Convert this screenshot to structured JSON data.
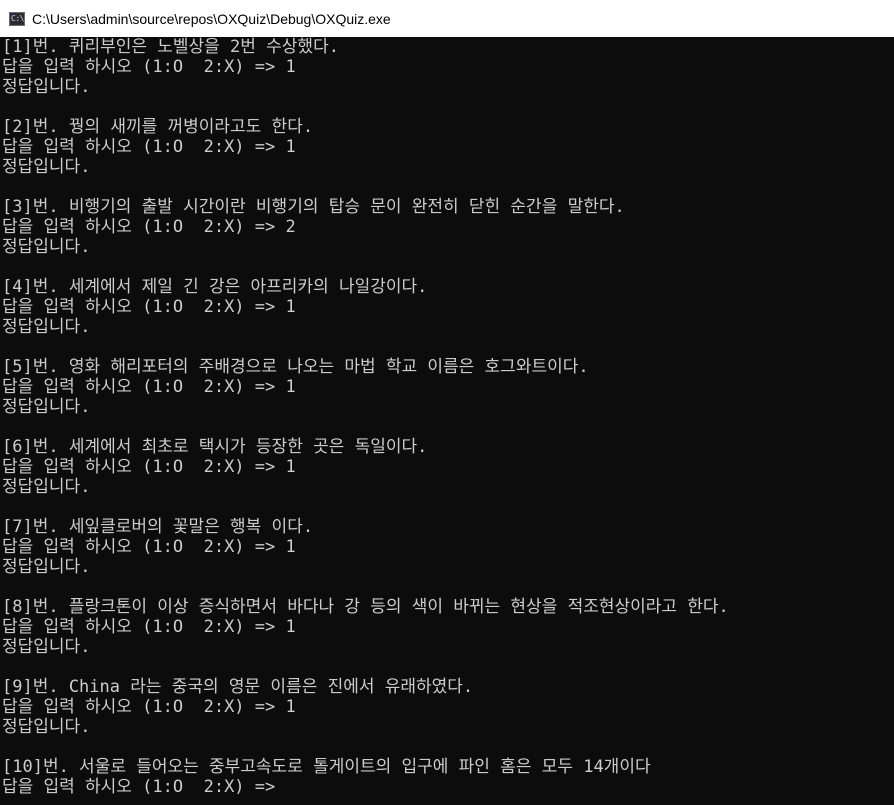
{
  "window": {
    "title": "C:\\Users\\admin\\source\\repos\\OXQuiz\\Debug\\OXQuiz.exe",
    "icon": "console-app-icon",
    "icon_glyph": "C:\\"
  },
  "colors": {
    "console_background": "#0c0c0c",
    "console_text": "#cccccc",
    "titlebar_background": "#ffffff"
  },
  "console": {
    "lines": [
      "[1]번. 퀴리부인은 노벨상을 2번 수상했다.",
      "답을 입력 하시오 (1:O  2:X) => 1",
      "정답입니다.",
      "",
      "[2]번. 꿩의 새끼를 꺼병이라고도 한다.",
      "답을 입력 하시오 (1:O  2:X) => 1",
      "정답입니다.",
      "",
      "[3]번. 비행기의 출발 시간이란 비행기의 탑승 문이 완전히 닫힌 순간을 말한다.",
      "답을 입력 하시오 (1:O  2:X) => 2",
      "정답입니다.",
      "",
      "[4]번. 세계에서 제일 긴 강은 아프리카의 나일강이다.",
      "답을 입력 하시오 (1:O  2:X) => 1",
      "정답입니다.",
      "",
      "[5]번. 영화 해리포터의 주배경으로 나오는 마법 학교 이름은 호그와트이다.",
      "답을 입력 하시오 (1:O  2:X) => 1",
      "정답입니다.",
      "",
      "[6]번. 세계에서 최초로 택시가 등장한 곳은 독일이다.",
      "답을 입력 하시오 (1:O  2:X) => 1",
      "정답입니다.",
      "",
      "[7]번. 세잎클로버의 꽃말은 행복 이다.",
      "답을 입력 하시오 (1:O  2:X) => 1",
      "정답입니다.",
      "",
      "[8]번. 플랑크톤이 이상 증식하면서 바다나 강 등의 색이 바뀌는 현상을 적조현상이라고 한다.",
      "답을 입력 하시오 (1:O  2:X) => 1",
      "정답입니다.",
      "",
      "[9]번. China 라는 중국의 영문 이름은 진에서 유래하였다.",
      "답을 입력 하시오 (1:O  2:X) => 1",
      "정답입니다.",
      "",
      "[10]번. 서울로 들어오는 중부고속도로 톨게이트의 입구에 파인 홈은 모두 14개이다",
      "답을 입력 하시오 (1:O  2:X) =>"
    ]
  }
}
